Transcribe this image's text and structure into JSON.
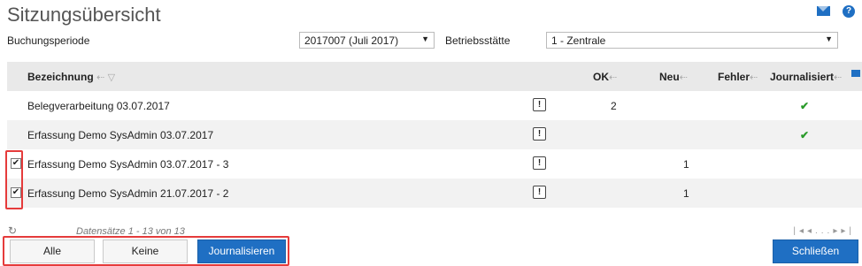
{
  "page": {
    "title": "Sitzungsübersicht"
  },
  "icons": {
    "mail": "mail-icon",
    "help": "help-icon"
  },
  "filters": {
    "period_label": "Buchungsperiode",
    "period_value": "2017007 (Juli 2017)",
    "site_label": "Betriebsstätte",
    "site_value": "1 - Zentrale"
  },
  "table": {
    "headers": {
      "bezeichnung": "Bezeichnung",
      "ok": "OK",
      "neu": "Neu",
      "fehler": "Fehler",
      "journalisiert": "Journalisiert"
    },
    "rows": [
      {
        "name": "Belegverarbeitung 03.07.2017",
        "ok": "2",
        "neu": "",
        "journalized": true,
        "checked": false,
        "has_checkbox": false
      },
      {
        "name": "Erfassung Demo SysAdmin 03.07.2017",
        "ok": "",
        "neu": "",
        "journalized": true,
        "checked": false,
        "has_checkbox": false
      },
      {
        "name": "Erfassung Demo SysAdmin 03.07.2017 - 3",
        "ok": "",
        "neu": "1",
        "journalized": false,
        "checked": true,
        "has_checkbox": true
      },
      {
        "name": "Erfassung Demo SysAdmin 21.07.2017 - 2",
        "ok": "",
        "neu": "1",
        "journalized": false,
        "checked": true,
        "has_checkbox": true
      }
    ]
  },
  "footer": {
    "records": "Datensätze 1 - 13 von 13",
    "pager_dots": "..."
  },
  "buttons": {
    "all": "Alle",
    "none": "Keine",
    "journalize": "Journalisieren",
    "close": "Schließen"
  },
  "colors": {
    "accent": "#1f6fc3",
    "highlight": "#e53b3b",
    "check": "#2a9a2a"
  }
}
